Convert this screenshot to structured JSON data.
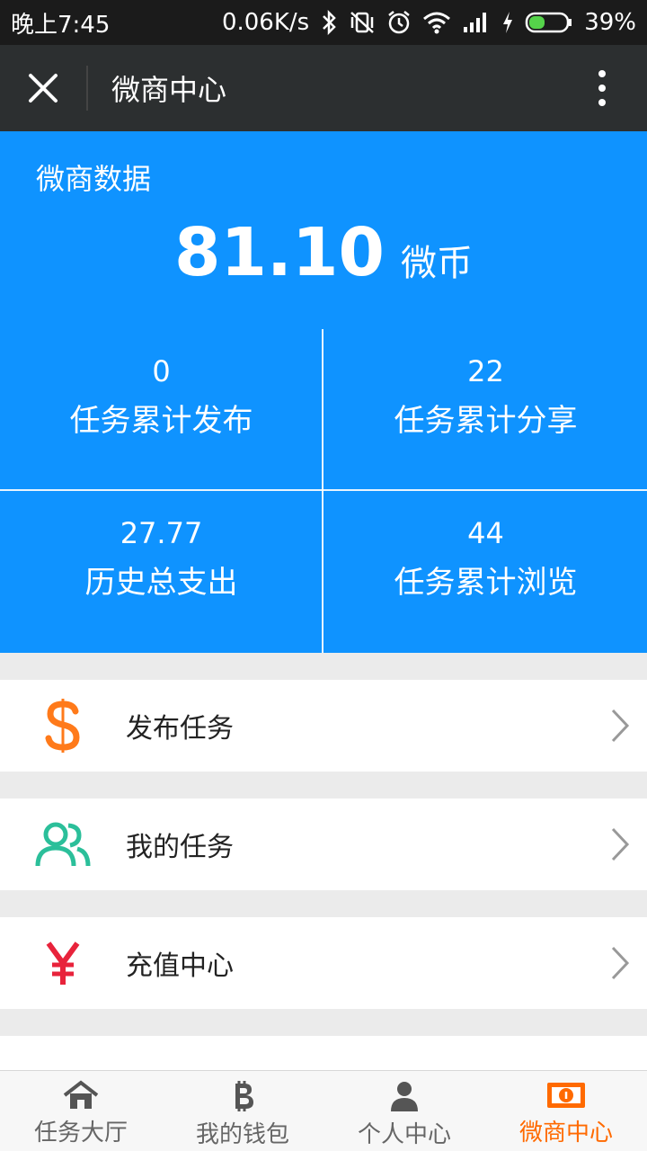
{
  "status_bar": {
    "time": "晚上7:45",
    "speed": "0.06K/s",
    "battery": "39%"
  },
  "title_bar": {
    "title": "微商中心"
  },
  "stats": {
    "heading": "微商数据",
    "balance_value": "81.10",
    "balance_unit": "微币",
    "cells": [
      {
        "value": "0",
        "label": "任务累计发布"
      },
      {
        "value": "22",
        "label": "任务累计分享"
      },
      {
        "value": "27.77",
        "label": "历史总支出"
      },
      {
        "value": "44",
        "label": "任务累计浏览"
      }
    ]
  },
  "menu": {
    "items": [
      {
        "label": "发布任务",
        "icon": "dollar-icon",
        "color": "#ff7a1a"
      },
      {
        "label": "我的任务",
        "icon": "users-icon",
        "color": "#2bbf9a"
      },
      {
        "label": "充值中心",
        "icon": "yuan-icon",
        "color": "#e8233b"
      }
    ]
  },
  "bottom_nav": {
    "items": [
      {
        "label": "任务大厅",
        "icon": "home-icon"
      },
      {
        "label": "我的钱包",
        "icon": "bitcoin-icon"
      },
      {
        "label": "个人中心",
        "icon": "person-icon"
      },
      {
        "label": "微商中心",
        "icon": "money-icon",
        "active": true
      }
    ],
    "active_color": "#ff6a00"
  },
  "colors": {
    "stats_bg": "#0f93ff",
    "title_bg": "#2c2f30",
    "status_bg": "#1b1b1b"
  }
}
